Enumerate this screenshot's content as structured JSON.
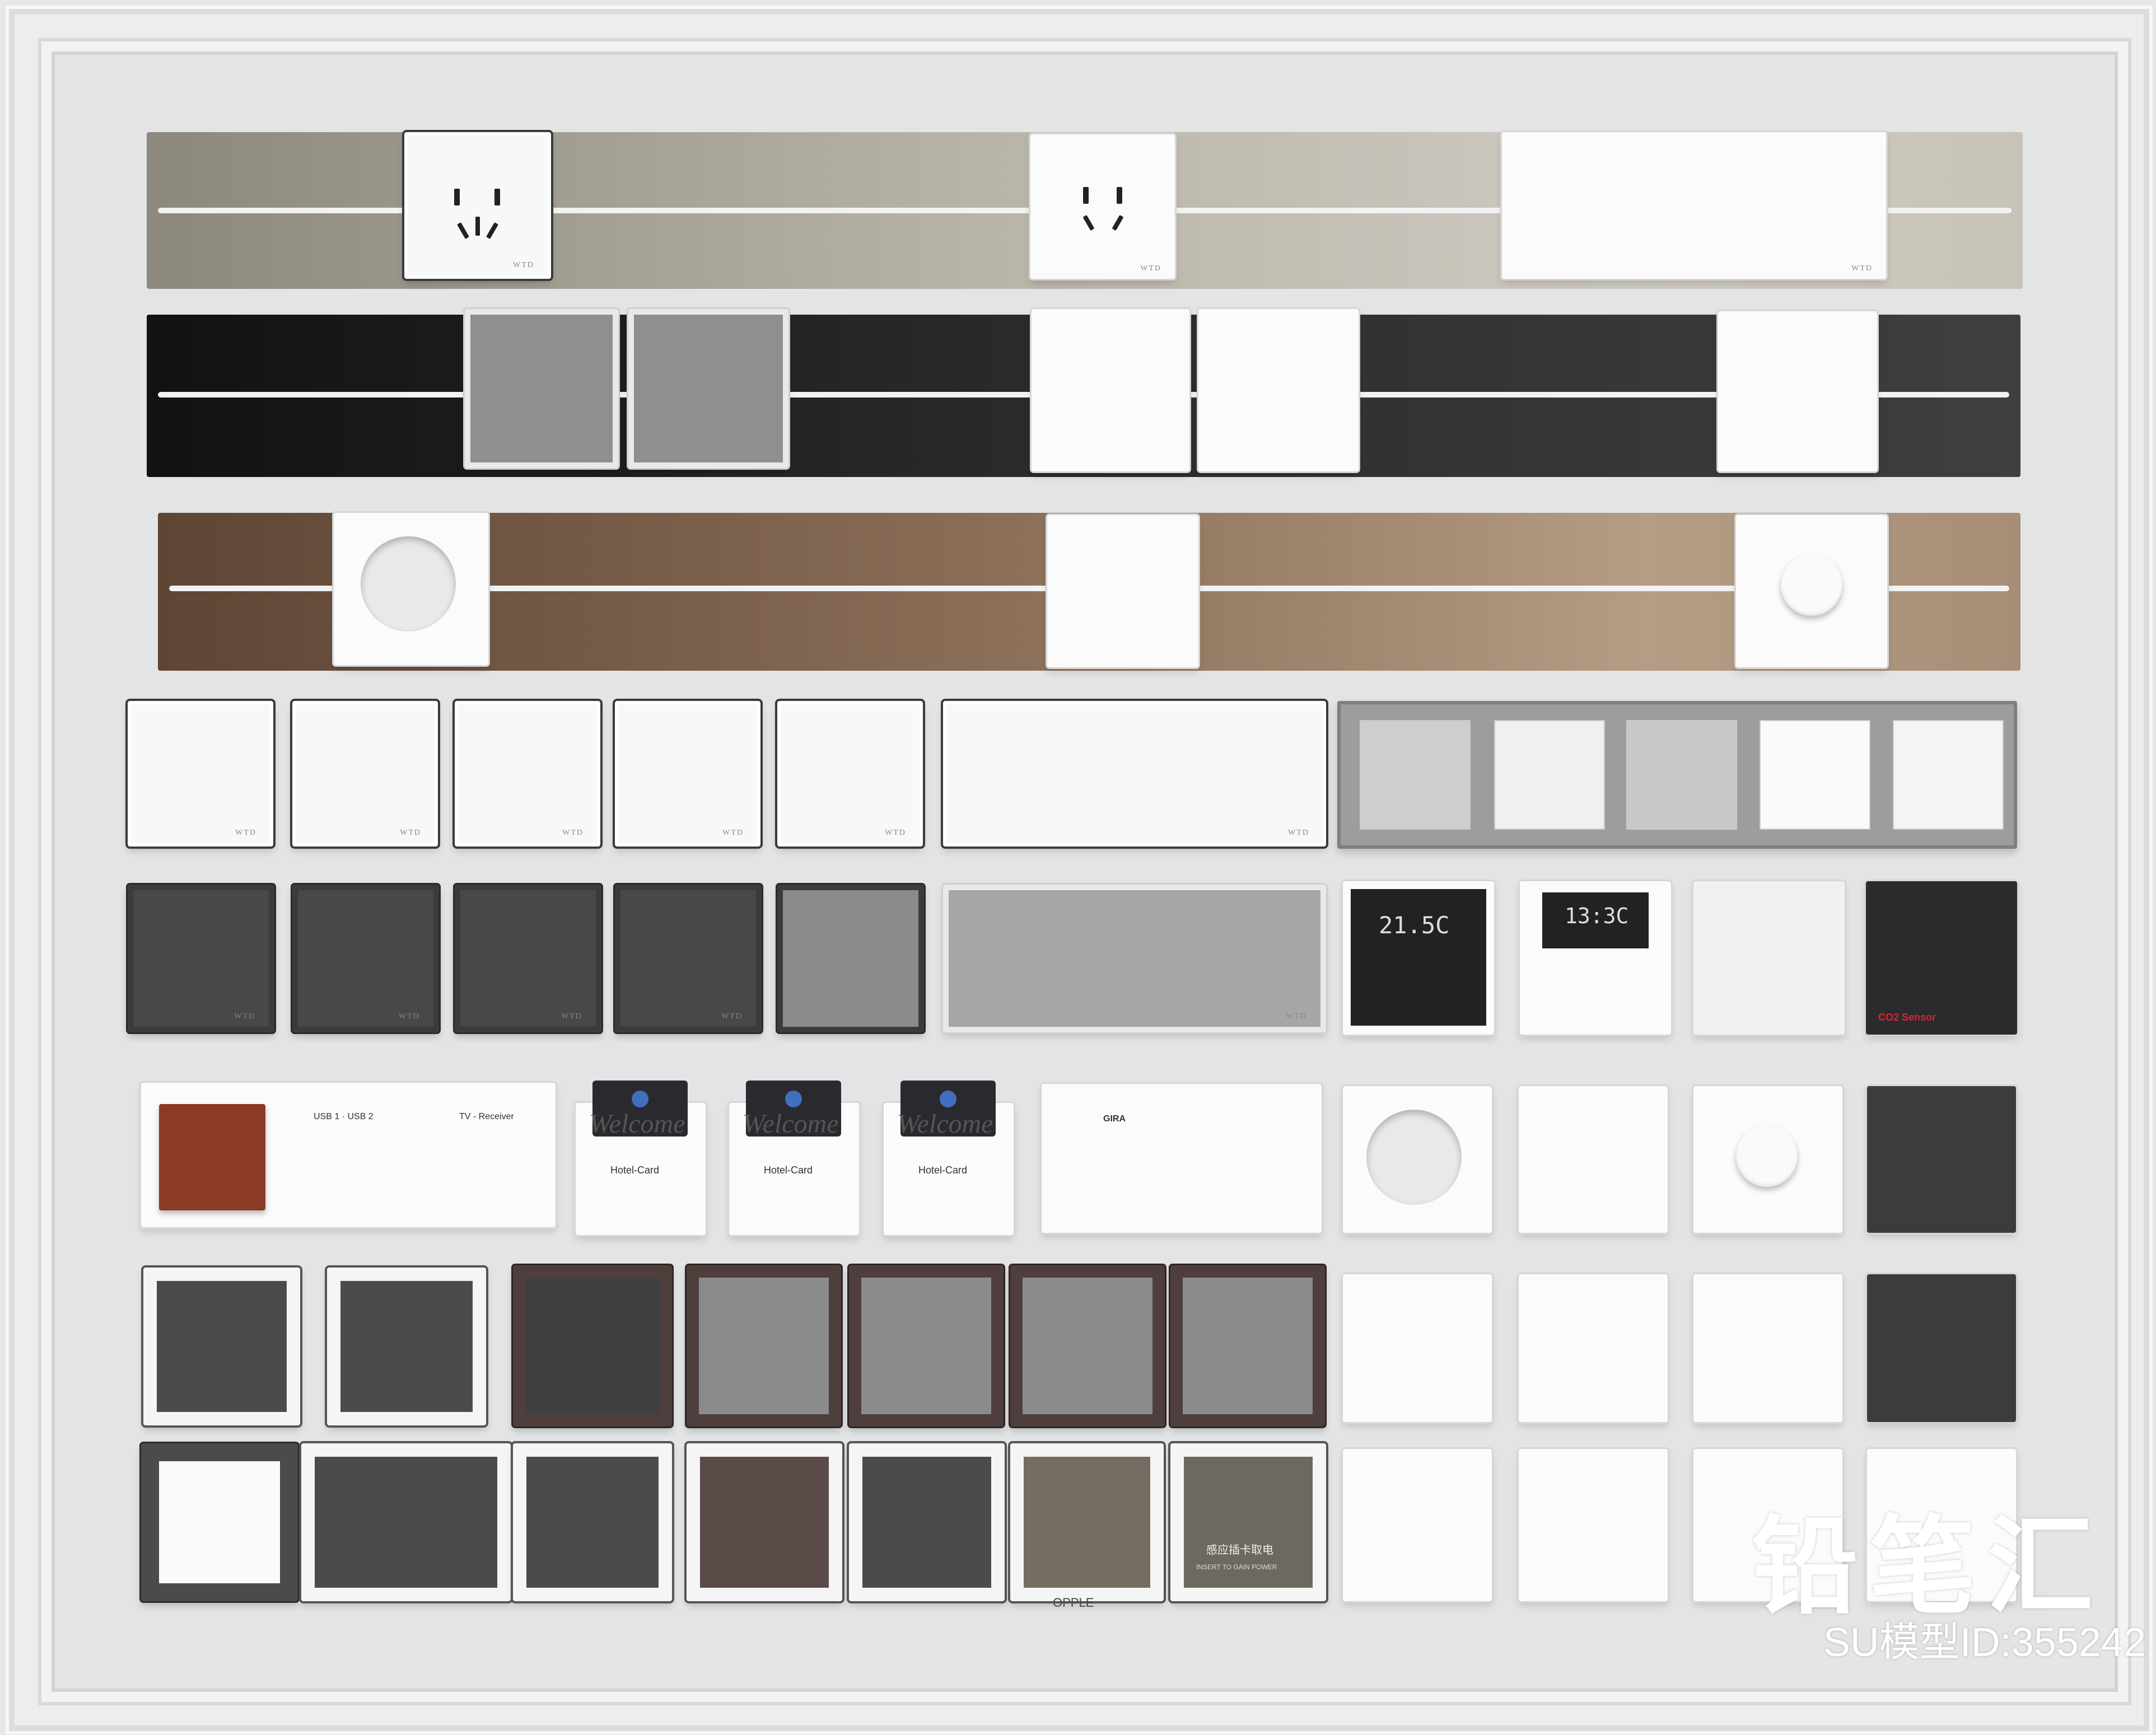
{
  "brand_mark": "WTD",
  "hotel_welcome": "Welcome",
  "hotel_card_label": "Hotel-Card",
  "usb_label": "USB 1 · USB 2",
  "tv_label": "TV - Receiver",
  "gira_label": "GIRA",
  "thermostat_temp": "21.5C",
  "display_time": "13:3C",
  "co2_label": "CO2 Sensor",
  "opple_label": "OPPLE",
  "keycard_text": "感应插卡取电",
  "keycard_sub": "INSERT TO GAIN POWER",
  "watermark_title": "铅笔汇",
  "watermark_id": "SU模型ID:355242",
  "colors": {
    "rail_champagne": "#b8b3a8",
    "rail_black": "#2c2d2f",
    "rail_bronze": "#8a6e58",
    "panel_white": "#f8f8f8",
    "panel_dark": "#47484a"
  }
}
